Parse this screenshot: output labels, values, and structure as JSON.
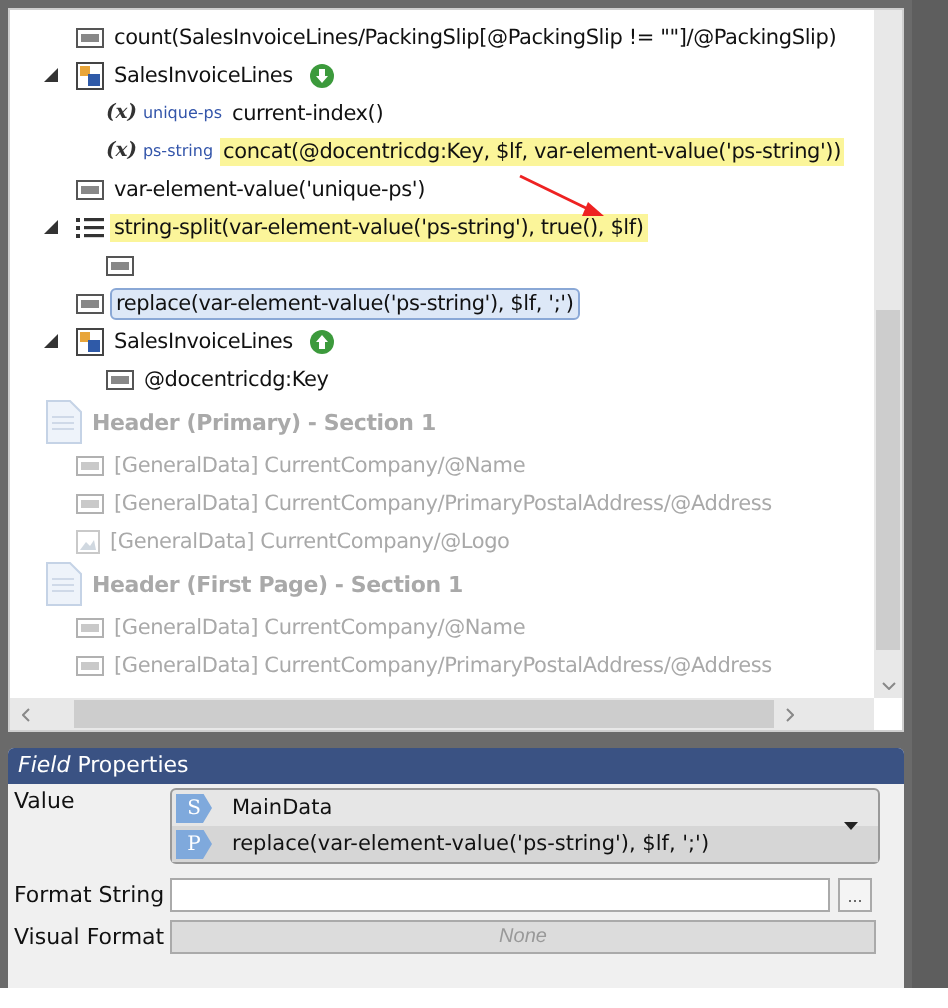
{
  "tree": {
    "items": [
      {
        "kind": "expression",
        "text": "count(SalesInvoiceLines/PackingSlip[@PackingSlip != \"\"]/@PackingSlip)",
        "highlighted": false,
        "selected": false
      },
      {
        "kind": "table",
        "text": "SalesInvoiceLines",
        "arrow_up": false,
        "expanded": true,
        "highlighted": false,
        "selected": false,
        "children": [
          {
            "kind": "variable",
            "icon_text": "(x)",
            "variable": "unique-ps",
            "text": "current-index()",
            "highlighted": false,
            "selected": false
          },
          {
            "kind": "variable",
            "icon_text": "(x)",
            "variable": "ps-string",
            "text": "concat(@docentricdg:Key, $lf, var-element-value('ps-string'))",
            "highlighted": true,
            "selected": false
          }
        ]
      },
      {
        "kind": "expression",
        "text": "var-element-value('unique-ps')",
        "highlighted": false,
        "selected": false
      },
      {
        "kind": "list",
        "text": "string-split(var-element-value('ps-string'), true(), $lf)",
        "expanded": true,
        "highlighted": true,
        "selected": false,
        "children": [
          {
            "kind": "expression"
          }
        ]
      },
      {
        "kind": "expression",
        "text": "replace(var-element-value('ps-string'), $lf, ';')",
        "highlighted": false,
        "selected": true
      },
      {
        "kind": "table",
        "text": "SalesInvoiceLines",
        "arrow_up": true,
        "expanded": true,
        "highlighted": false,
        "selected": false,
        "children": [
          {
            "kind": "expression",
            "text": "@docentricdg:Key",
            "highlighted": false,
            "selected": false
          }
        ]
      }
    ],
    "sections": [
      {
        "kind": "section",
        "text": "Header (Primary) - Section 1",
        "disabled": true,
        "children": [
          {
            "kind": "expression",
            "text": "[GeneralData] CurrentCompany/@Name",
            "disabled": true
          },
          {
            "kind": "expression",
            "text": "[GeneralData] CurrentCompany/PrimaryPostalAddress/@Address",
            "disabled": true
          },
          {
            "kind": "image",
            "text": "[GeneralData] CurrentCompany/@Logo",
            "disabled": true
          }
        ]
      },
      {
        "kind": "section",
        "text": "Header (First Page) - Section 1",
        "disabled": true,
        "children": [
          {
            "kind": "expression",
            "text": "[GeneralData] CurrentCompany/@Name",
            "disabled": true
          },
          {
            "kind": "expression",
            "text": "[GeneralData] CurrentCompany/PrimaryPostalAddress/@Address",
            "disabled": true
          }
        ]
      }
    ]
  },
  "properties": {
    "title": "*Field* Properties",
    "value": {
      "label": "Value",
      "sources": [
        {
          "badge": "S",
          "text": "MainData"
        },
        {
          "badge": "P",
          "text": "replace(var-element-value('ps-string'), $lf, ';')"
        }
      ]
    },
    "format_string": {
      "label": "Format String",
      "button": "..."
    },
    "visual_format": {
      "label": "Visual Format",
      "placeholder": "None",
      "disabled": true
    }
  }
}
